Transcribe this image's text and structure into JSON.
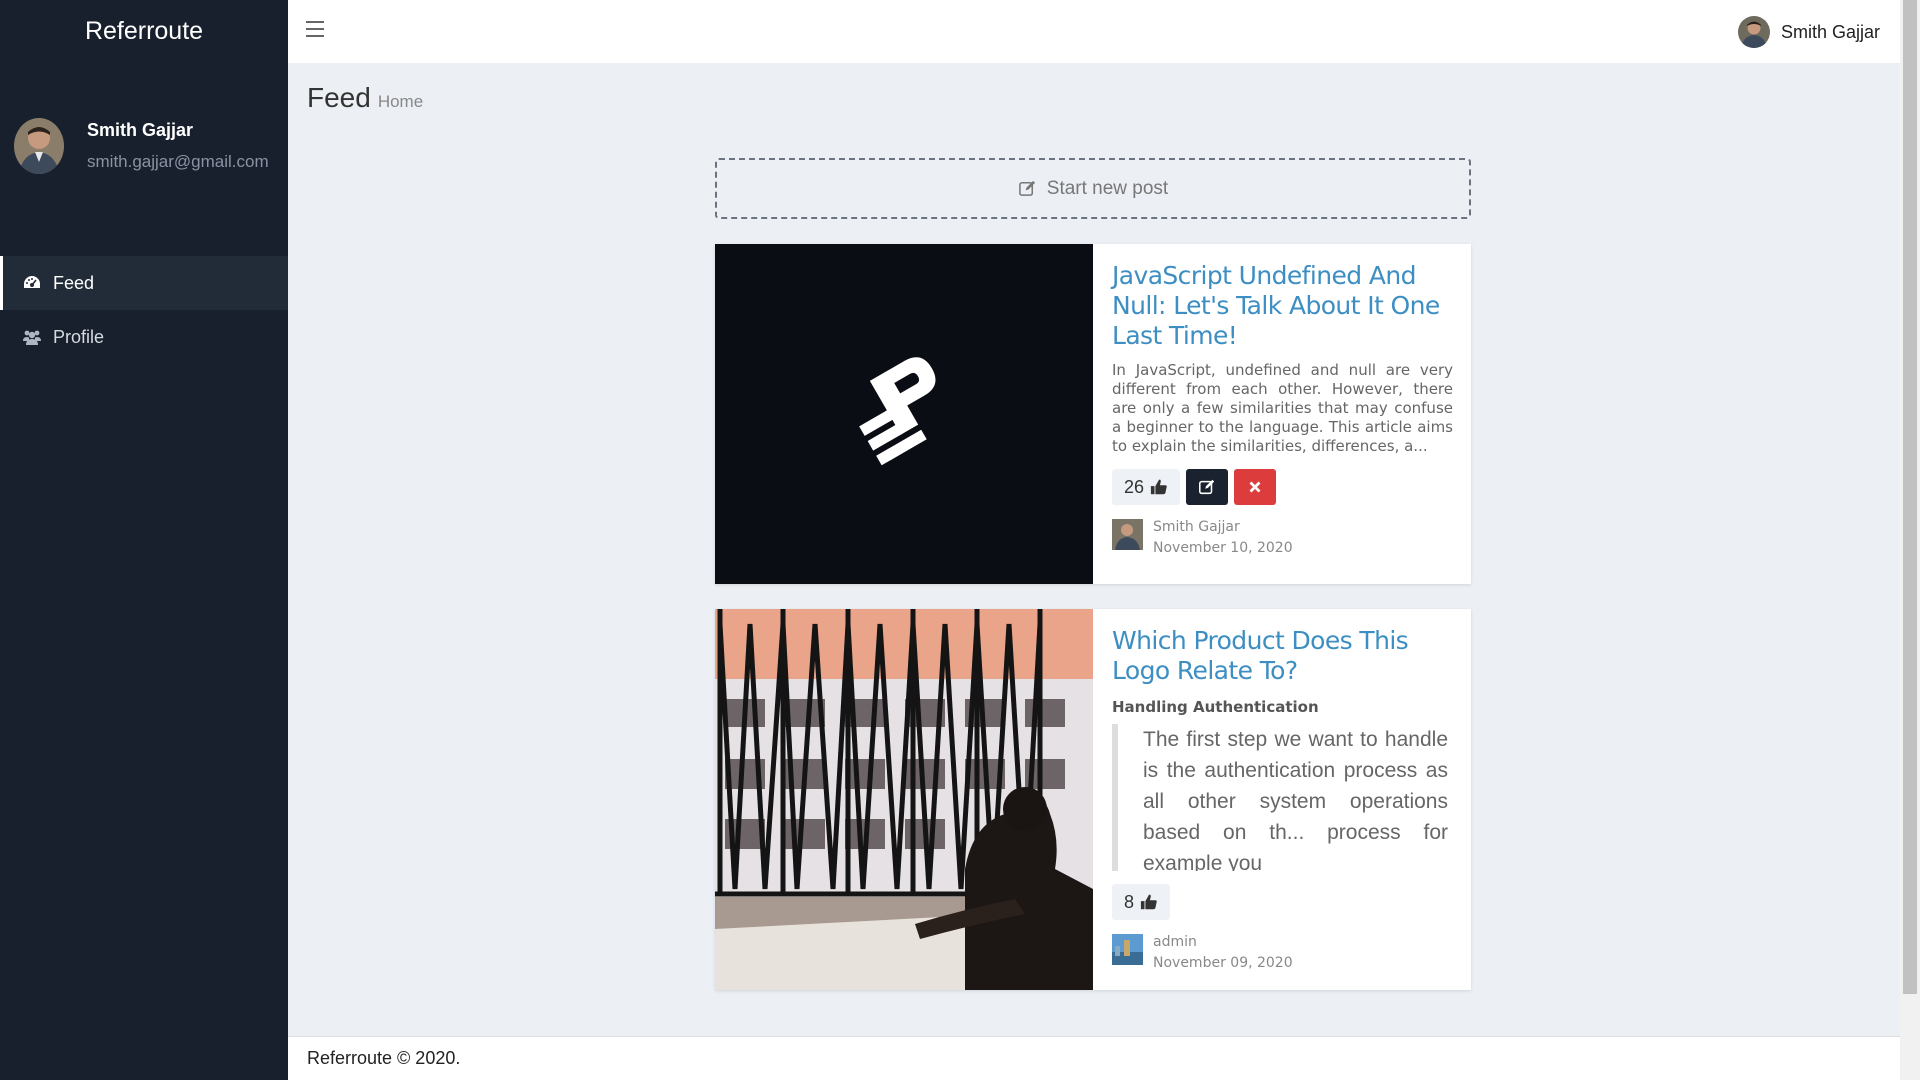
{
  "app": {
    "brand": "Referroute"
  },
  "user": {
    "name": "Smith Gajjar",
    "email": "smith.gajjar@gmail.com"
  },
  "sidebar": {
    "items": [
      {
        "label": "Feed",
        "icon": "dashboard-icon",
        "active": true
      },
      {
        "label": "Profile",
        "icon": "users-icon",
        "active": false
      }
    ]
  },
  "header": {
    "user_name": "Smith Gajjar"
  },
  "page": {
    "title": "Feed",
    "breadcrumb": "Home"
  },
  "new_post": {
    "label": "Start new post"
  },
  "posts": [
    {
      "title": "JavaScript Undefined And Null: Let's Talk About It One Last Time!",
      "excerpt": "In JavaScript, undefined and null are very different from each other. However, there are only a few similarities that may confuse a beginner to the language. This article aims to explain the similarities, differences, a...",
      "likes": "26",
      "author": "Smith Gajjar",
      "date": "November 10, 2020"
    },
    {
      "title": "Which Product Does This Logo Relate To?",
      "subheading": "Handling Authentication",
      "quote": "The first step we want to handle is the authentication process as all other system operations based on th... process for example you",
      "likes": "8",
      "author": "admin",
      "date": "November 09, 2020"
    }
  ],
  "footer": {
    "text": "Referroute © 2020."
  },
  "colors": {
    "sidebar": "#18202d",
    "link": "#3d8ec3",
    "danger": "#dc3c3c",
    "dark_button": "#1a2230"
  }
}
